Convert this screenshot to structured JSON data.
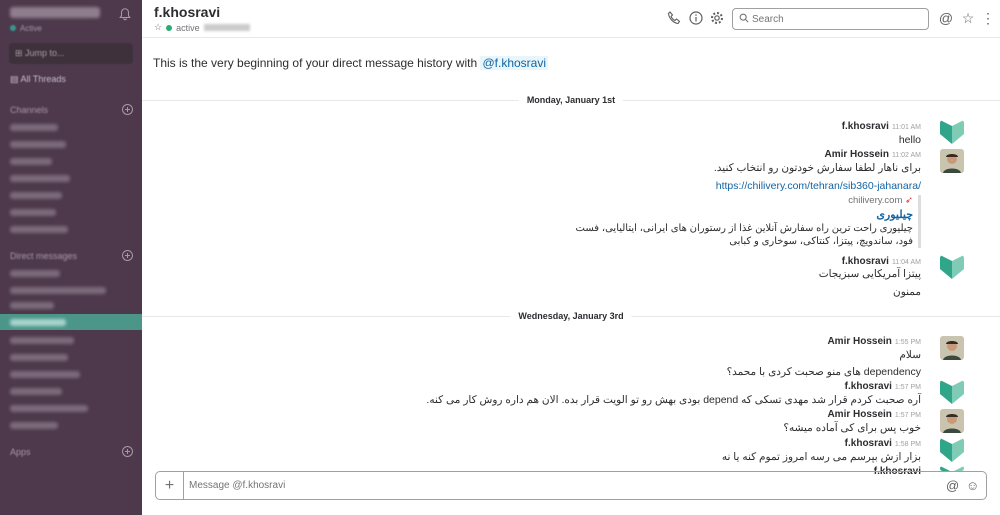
{
  "sidebar": {
    "team_name": "",
    "user_status": "Active",
    "jump_label": "Jump to...",
    "threads_label": "All Threads",
    "channels_label": "Channels",
    "dm_label": "Direct messages",
    "apps_label": "Apps"
  },
  "header": {
    "title": "f.khosravi",
    "status": "active",
    "search_placeholder": "Search"
  },
  "intro": {
    "text": "This is the very beginning of your direct message history with ",
    "mention": "@f.khosravi"
  },
  "days": [
    {
      "label": "Monday, January 1st"
    },
    {
      "label": "Wednesday, January 3rd"
    }
  ],
  "messages": [
    {
      "author": "f.khosravi",
      "time": "11:01 AM",
      "lines": [
        "hello"
      ]
    },
    {
      "author": "Amir Hossein",
      "time": "11:02 AM",
      "lines": [
        "برای ناهار لطفا سفارش خودتون رو انتخاب کنید."
      ],
      "link": "https://chilivery.com/tehran/sib360-jahanara/"
    },
    {
      "author": "f.khosravi",
      "time": "11:04 AM",
      "lines": [
        "پیتزا آمریکایی سبزیجات",
        "ممنون"
      ]
    },
    {
      "author": "Amir Hossein",
      "time": "1:55 PM",
      "lines": [
        "سلام",
        "dependency های منو صحبت کردی با محمد؟"
      ]
    },
    {
      "author": "f.khosravi",
      "time": "1:57 PM",
      "lines": [
        "آره صحبت کردم قرار شد مهدی تسکی که depend بودی بهش  رو تو الویت قرار بده. الان هم داره روش کار می کنه."
      ]
    },
    {
      "author": "Amir Hossein",
      "time": "1:57 PM",
      "lines": [
        "خوب پس برای کی آماده میشه؟"
      ]
    },
    {
      "author": "f.khosravi",
      "time": "1:58 PM",
      "lines": [
        "بزار ازش بپرسم می رسه امروز تموم کنه یا نه"
      ]
    },
    {
      "author": "f.khosravi",
      "time": "",
      "lines": []
    }
  ],
  "preview": {
    "site": "chilivery.com",
    "title": "چیلیوری",
    "desc_1": "چیلیوری راحت ترین راه سفارش آنلاین غذا از رستوران های ایرانی، ایتالیایی، فست",
    "desc_2": "فود، ساندویچ، پیتزا، کنتاکی، سوخاری و کبابی"
  },
  "composer": {
    "placeholder": "Message @f.khosravi",
    "plus": "+"
  },
  "colors": {
    "sidebar_bg": "#4d394b",
    "active_item": "#4c9689",
    "link": "#1264a3"
  }
}
